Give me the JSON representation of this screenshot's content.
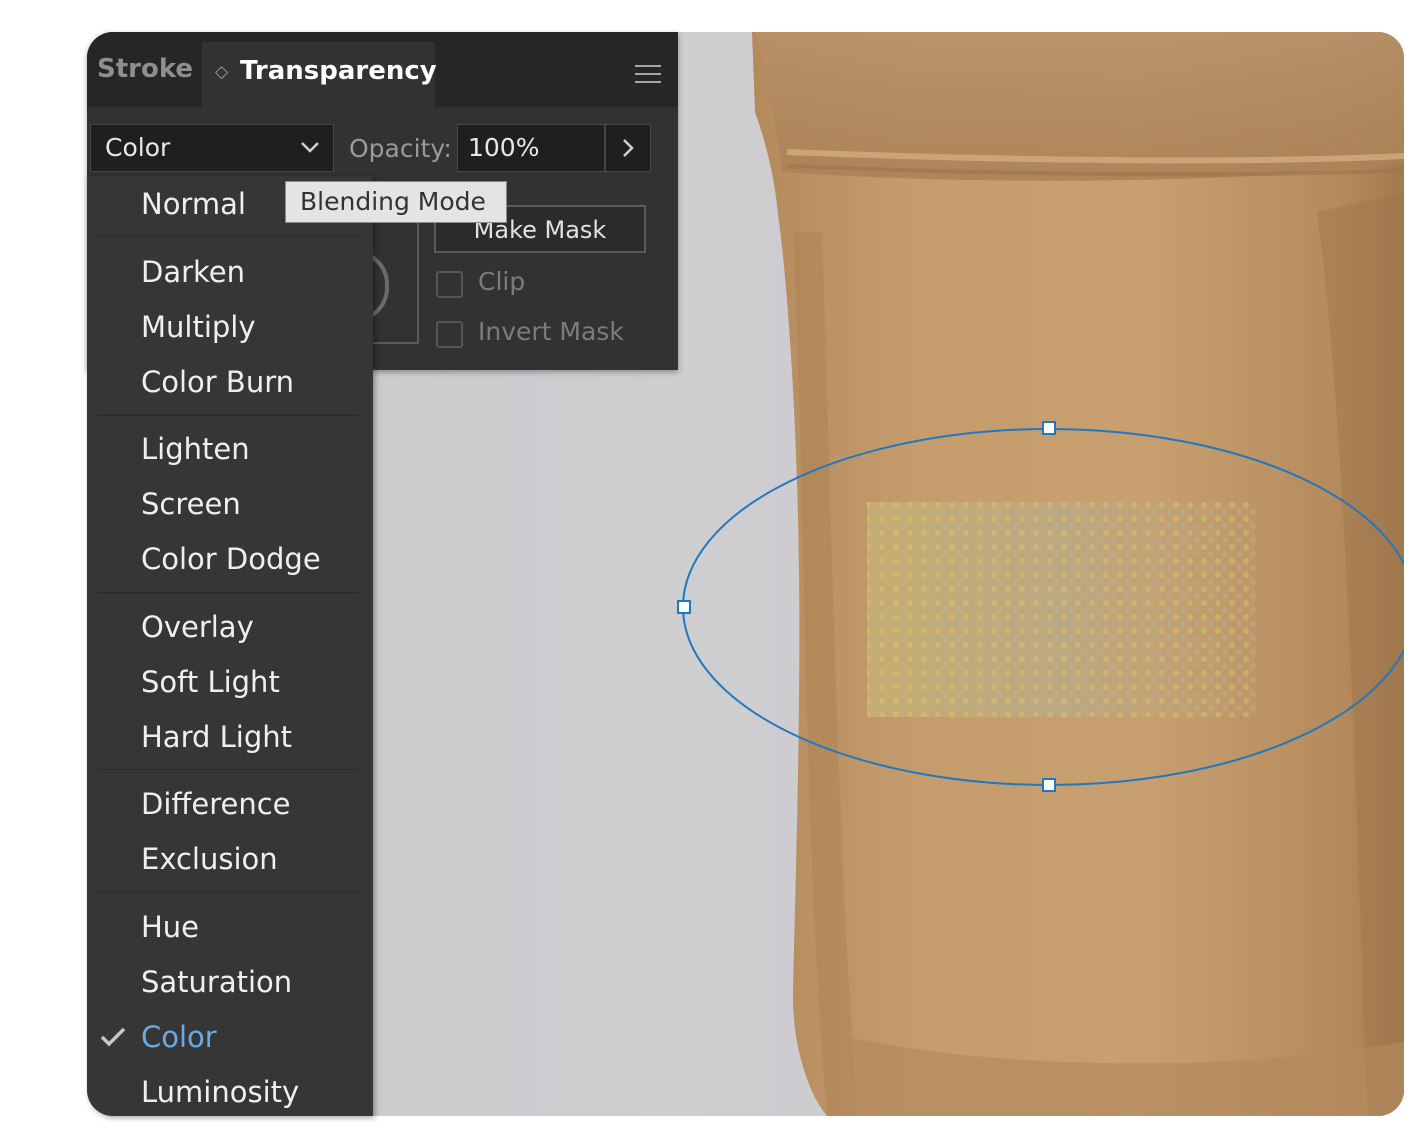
{
  "panel": {
    "tabs": [
      {
        "label": "Stroke"
      },
      {
        "label": "Transparency"
      }
    ],
    "blend_mode_value": "Color",
    "opacity_label": "Opacity:",
    "opacity_value": "100%",
    "make_mask_label": "Make Mask",
    "clip_label": "Clip",
    "invert_mask_label": "Invert Mask"
  },
  "tooltip": {
    "text": "Blending Mode"
  },
  "blend_modes": {
    "items": [
      {
        "label": "Normal"
      },
      {
        "label": "Darken"
      },
      {
        "label": "Multiply"
      },
      {
        "label": "Color Burn"
      },
      {
        "label": "Lighten"
      },
      {
        "label": "Screen"
      },
      {
        "label": "Color Dodge"
      },
      {
        "label": "Overlay"
      },
      {
        "label": "Soft Light"
      },
      {
        "label": "Hard Light"
      },
      {
        "label": "Difference"
      },
      {
        "label": "Exclusion"
      },
      {
        "label": "Hue"
      },
      {
        "label": "Saturation"
      },
      {
        "label": "Color"
      },
      {
        "label": "Luminosity"
      }
    ],
    "selected": "Color"
  },
  "colors": {
    "panel_bg": "#323232",
    "menu_bg": "#363636",
    "selected_text": "#69a9e6",
    "selection_stroke": "#1f78c0",
    "pouch": "#c29a6a"
  },
  "icons": [
    "panel-menu-icon",
    "chevron-down-icon",
    "chevron-right-icon",
    "checkmark-icon",
    "tab-arrows-icon"
  ]
}
